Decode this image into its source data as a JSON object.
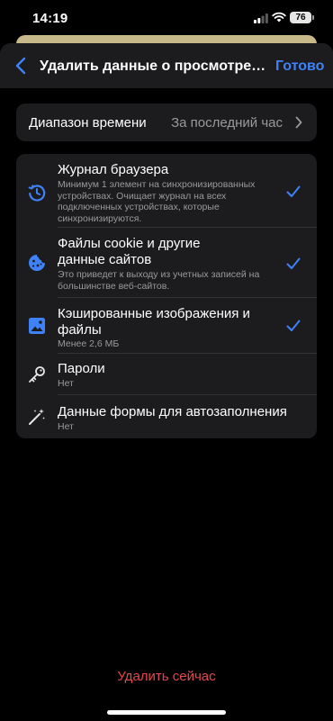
{
  "status_bar": {
    "time": "14:19",
    "battery": "76"
  },
  "nav": {
    "title": "Удалить данные о просмотре веб…",
    "done": "Готово"
  },
  "time_range": {
    "label": "Диапазон времени",
    "value": "За последний час"
  },
  "options": [
    {
      "title": "Журнал браузера",
      "subtitle": "Минимум 1 элемент на синхронизированных устройствах. Очищает журнал на всех подключенных устройствах, которые синхронизируются.",
      "checked": true
    },
    {
      "title": "Файлы cookie и другие данные сайтов",
      "subtitle": "Это приведет к выходу из учетных записей на большинстве веб-сайтов.",
      "checked": true
    },
    {
      "title": "Кэшированные изображения и файлы",
      "subtitle": "Менее 2,6 МБ",
      "checked": true
    },
    {
      "title": "Пароли",
      "subtitle": "Нет",
      "checked": false
    },
    {
      "title": "Данные формы для автозаполнения",
      "subtitle": "Нет",
      "checked": false
    }
  ],
  "delete_button": "Удалить сейчас",
  "colors": {
    "accent": "#3f82f7",
    "destructive": "#e5484d"
  }
}
